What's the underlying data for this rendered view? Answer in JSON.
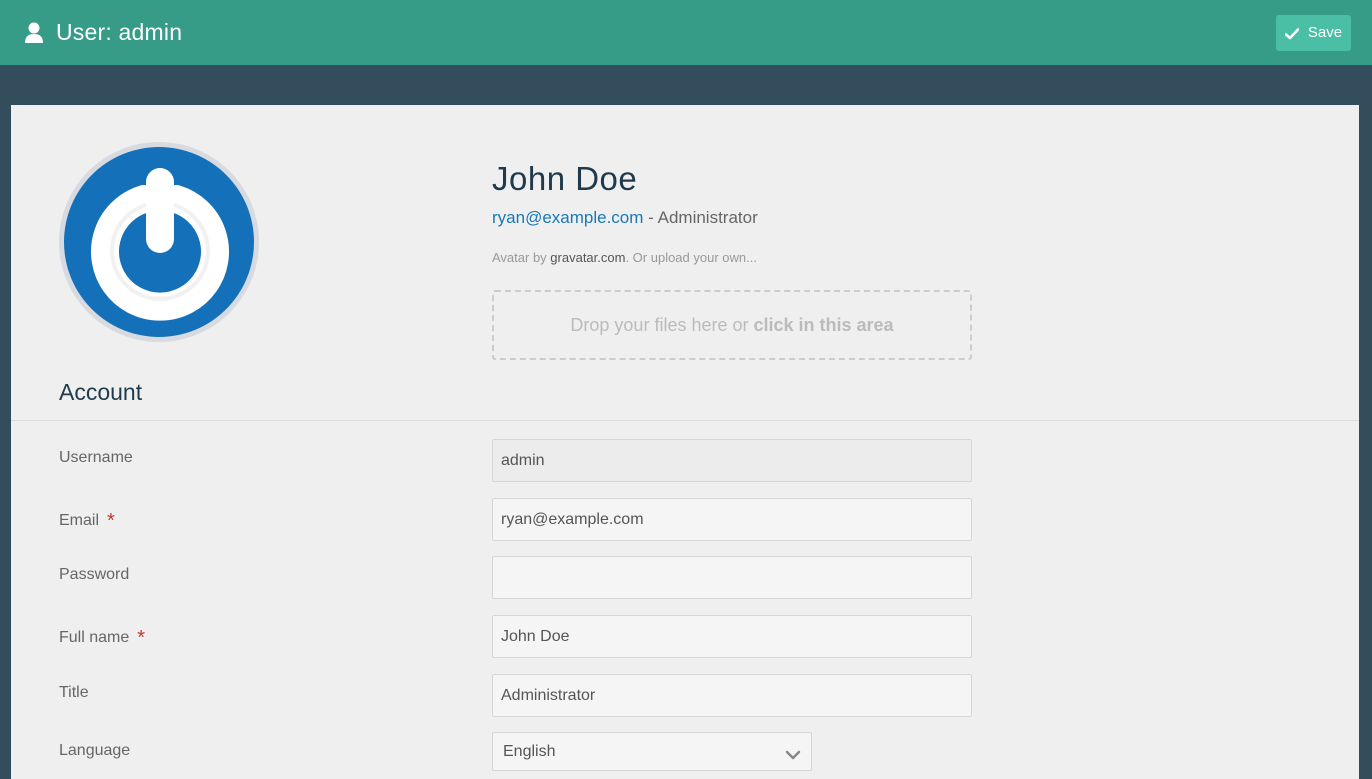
{
  "header": {
    "title": "User: admin",
    "save_label": "Save",
    "icons": {
      "user": "user-icon",
      "save": "check-icon"
    }
  },
  "profile": {
    "name": "John Doe",
    "email": "ryan@example.com",
    "role_sep": " - ",
    "role": "Administrator",
    "avatar_prefix": "Avatar by ",
    "avatar_link": "gravatar.com",
    "avatar_suffix": ". Or upload your own...",
    "dropzone_prefix": "Drop your files here or ",
    "dropzone_bold": "click in this area"
  },
  "account": {
    "section_title": "Account",
    "fields": [
      {
        "label": "Username",
        "value": "admin",
        "required": false,
        "readonly": true
      },
      {
        "label": "Email",
        "value": "ryan@example.com",
        "required": true
      },
      {
        "label": "Password",
        "value": "",
        "required": false
      },
      {
        "label": "Full name",
        "value": "John Doe",
        "required": true
      },
      {
        "label": "Title",
        "value": "Administrator",
        "required": false
      }
    ],
    "language": {
      "label": "Language",
      "value": "English"
    },
    "required_mark": "*"
  },
  "colors": {
    "header": "#369c87",
    "save_button": "#4bbfa6",
    "background": "#334d5c",
    "panel": "#efefef",
    "link": "#1a78b5",
    "required": "#c0392b",
    "avatar": "#1470b8"
  }
}
